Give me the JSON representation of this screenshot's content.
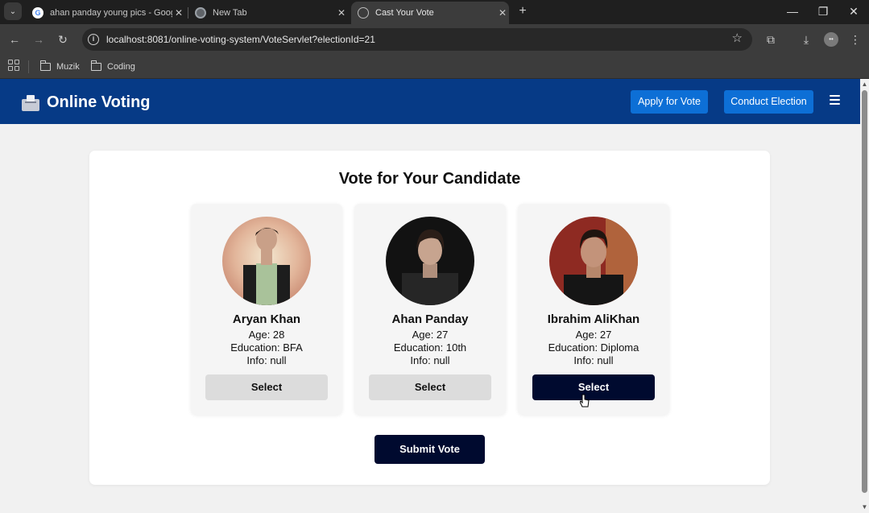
{
  "browser": {
    "tabs": [
      {
        "title": "ahan panday young pics - Goog",
        "favicon": "google-icon"
      },
      {
        "title": "New Tab",
        "favicon": "chrome-icon"
      },
      {
        "title": "Cast Your Vote",
        "favicon": "globe-icon",
        "active": true
      }
    ],
    "new_tab_symbol": "+",
    "url": "localhost:8081/online-voting-system/VoteServlet?electionId=21",
    "bookmarks": [
      {
        "label": "Muzik",
        "icon": "folder-icon"
      },
      {
        "label": "Coding",
        "icon": "folder-icon"
      }
    ],
    "icons": {
      "back": "←",
      "forward": "→",
      "reload": "↻",
      "star": "☆",
      "extensions": "⧉",
      "download": "⤓",
      "menu": "⋮",
      "minimize": "—",
      "restore": "❐",
      "close": "✕",
      "tab_close": "✕",
      "tab_search": "⌄",
      "info": "i"
    }
  },
  "navbar": {
    "brand": "Online Voting",
    "apply_label": "Apply for Vote",
    "conduct_label": "Conduct Election",
    "color": "#063a86",
    "button_color": "#0d6fd6"
  },
  "main": {
    "title": "Vote for Your Candidate",
    "candidates": [
      {
        "name": "Aryan Khan",
        "age": "Age: 28",
        "education": "Education: BFA",
        "info": "Info: null",
        "button": "Select",
        "selected": false
      },
      {
        "name": "Ahan Panday",
        "age": "Age: 27",
        "education": "Education: 10th",
        "info": "Info: null",
        "button": "Select",
        "selected": false
      },
      {
        "name": "Ibrahim AliKhan",
        "age": "Age: 27",
        "education": "Education: Diploma",
        "info": "Info: null",
        "button": "Select",
        "selected": true
      }
    ],
    "submit_label": "Submit Vote",
    "accent_color": "#000a2f"
  }
}
